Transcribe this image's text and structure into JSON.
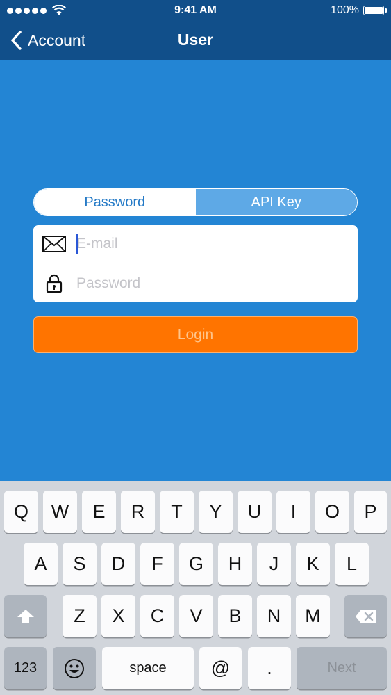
{
  "status_bar": {
    "time": "9:41 AM",
    "battery": "100%",
    "battery_level": 1.0
  },
  "nav": {
    "back_label": "Account",
    "title": "User"
  },
  "segment": {
    "options": [
      "Password",
      "API Key"
    ],
    "selected": "Password"
  },
  "form": {
    "email": {
      "placeholder": "E-mail",
      "value": "",
      "icon": "envelope-icon"
    },
    "password": {
      "placeholder": "Password",
      "value": "",
      "icon": "lock-icon"
    }
  },
  "login": {
    "label": "Login"
  },
  "keyboard": {
    "row1": [
      "Q",
      "W",
      "E",
      "R",
      "T",
      "Y",
      "U",
      "I",
      "O",
      "P"
    ],
    "row2": [
      "A",
      "S",
      "D",
      "F",
      "G",
      "H",
      "J",
      "K",
      "L"
    ],
    "row3": [
      "Z",
      "X",
      "C",
      "V",
      "B",
      "N",
      "M"
    ],
    "numbers_label": "123",
    "space_label": "space",
    "at_label": "@",
    "dot_label": ".",
    "next_label": "Next"
  },
  "colors": {
    "background": "#2385d4",
    "nav_bar": "#114f8a",
    "login_button": "#ff7400",
    "segment_inactive": "#5ea9e6"
  }
}
